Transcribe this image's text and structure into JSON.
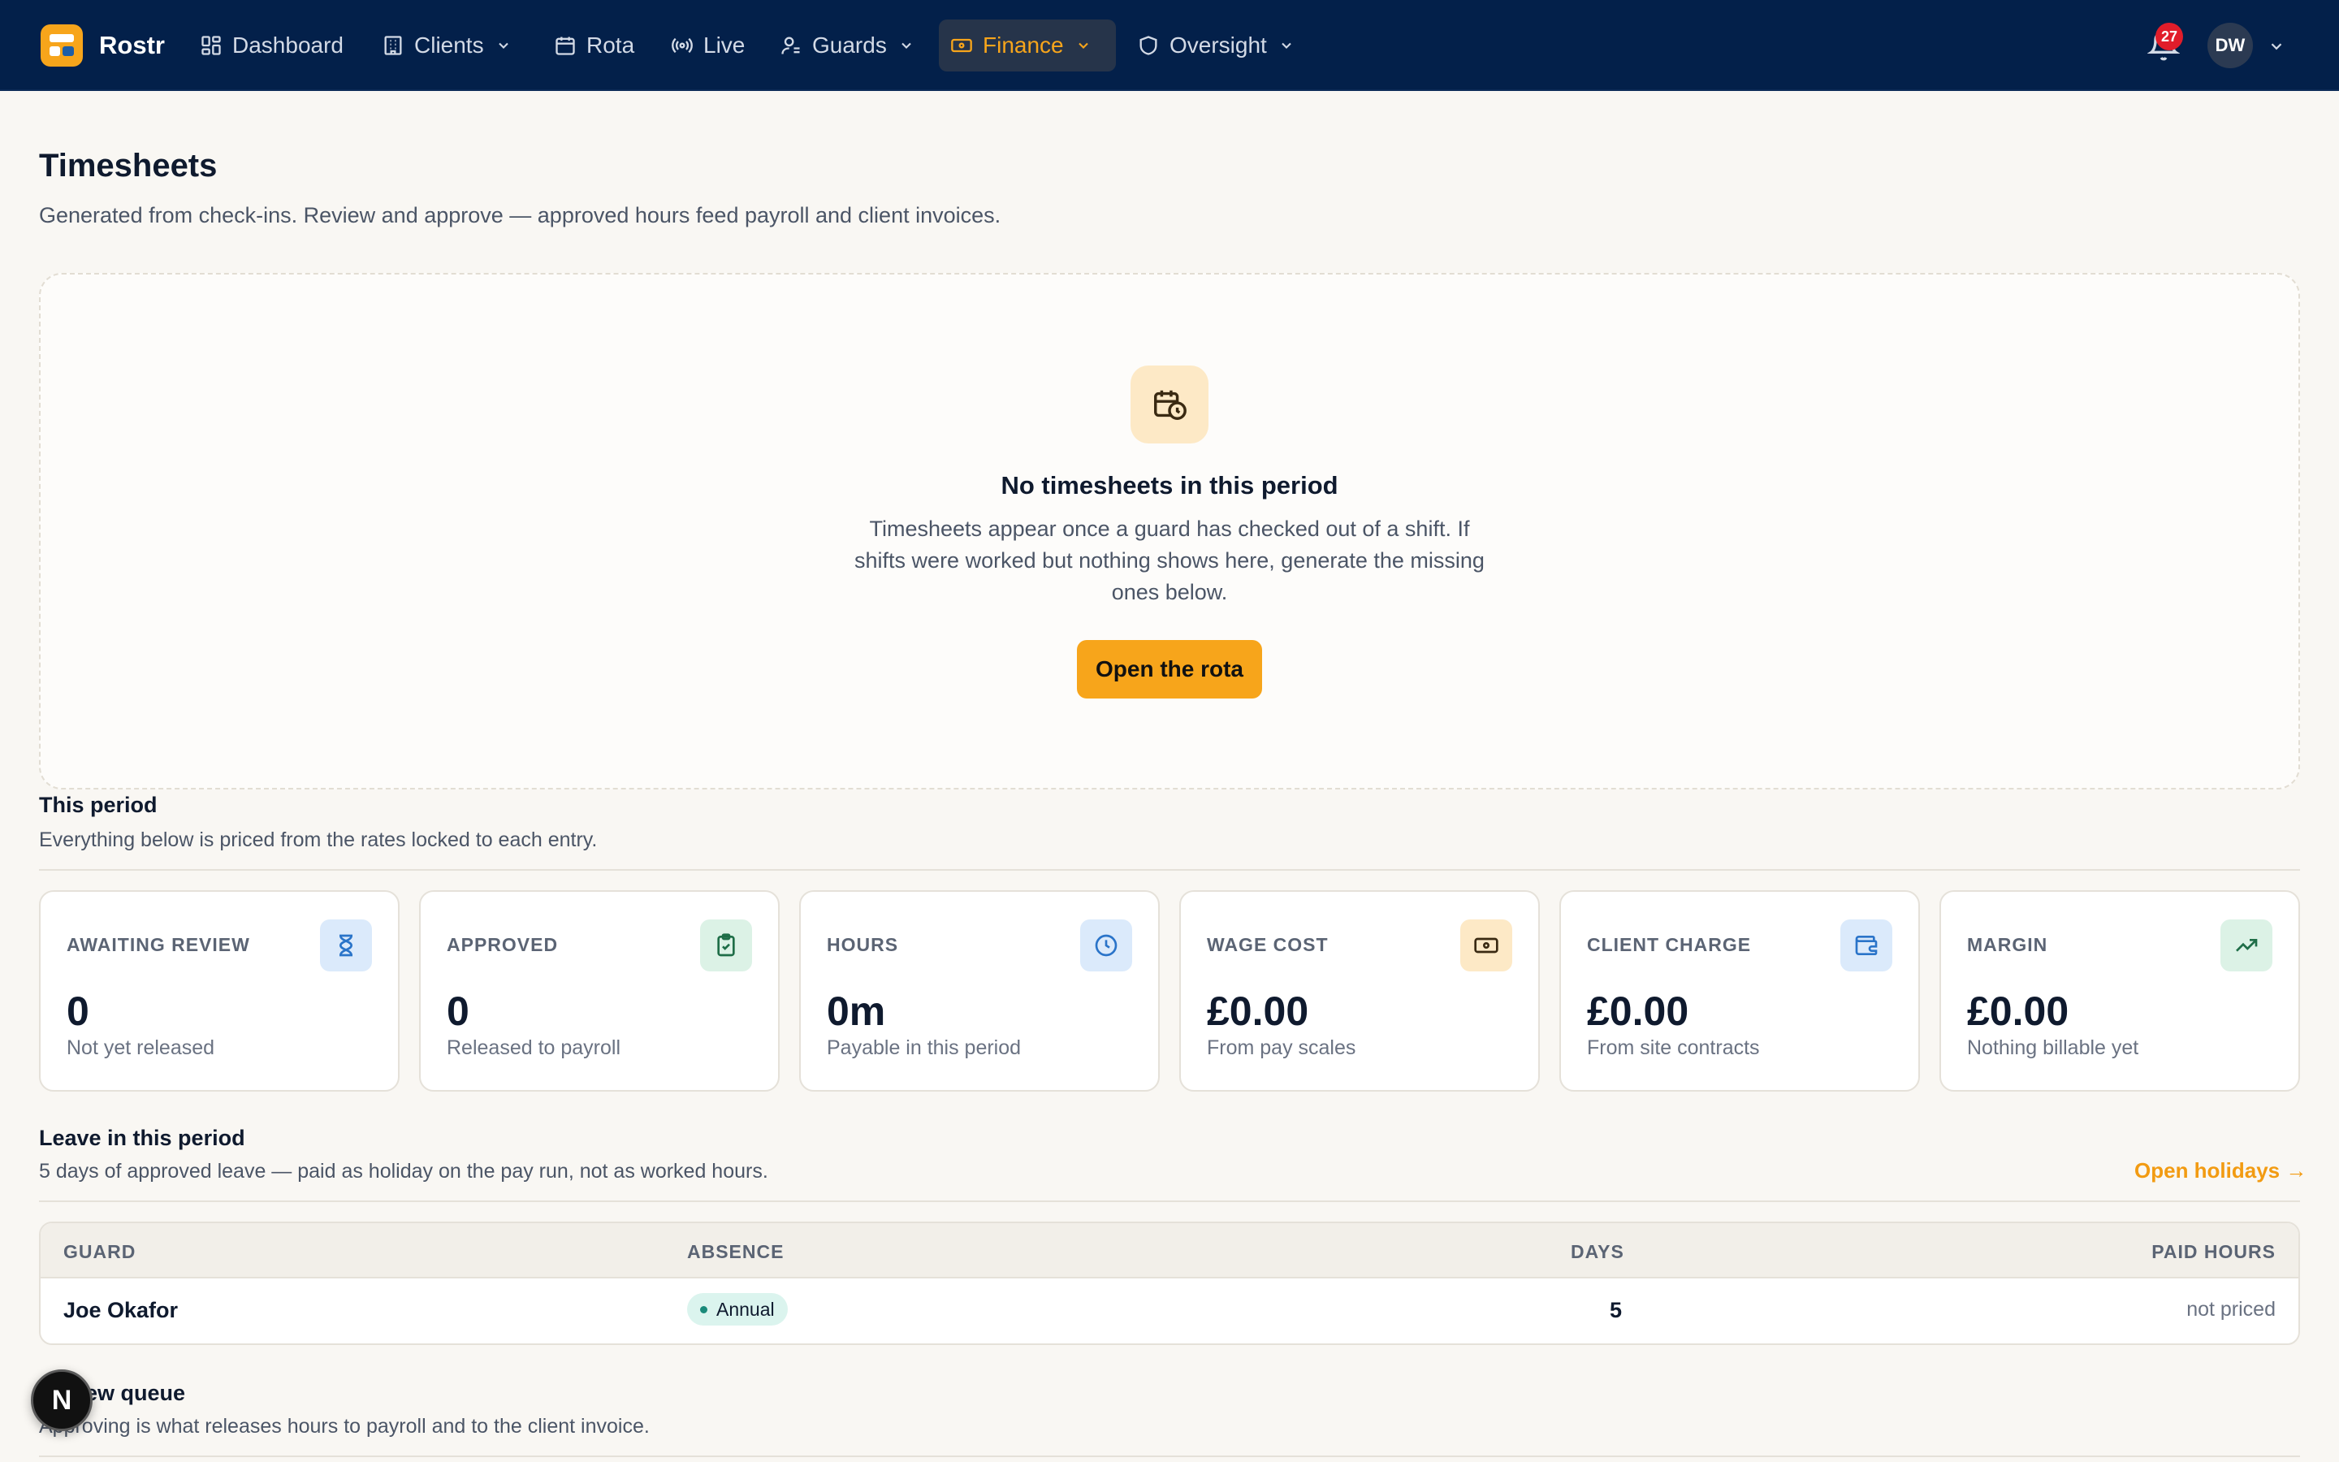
{
  "brand": {
    "name": "Rostr"
  },
  "nav": {
    "items": [
      {
        "label": "Dashboard",
        "icon": "grid-icon",
        "dropdown": false
      },
      {
        "label": "Clients",
        "icon": "building-icon",
        "dropdown": true
      },
      {
        "label": "Rota",
        "icon": "calendar-icon",
        "dropdown": false
      },
      {
        "label": "Live",
        "icon": "broadcast-icon",
        "dropdown": false
      },
      {
        "label": "Guards",
        "icon": "user-icon",
        "dropdown": true
      },
      {
        "label": "Finance",
        "icon": "banknote-icon",
        "dropdown": true,
        "active": true
      },
      {
        "label": "Oversight",
        "icon": "shield-icon",
        "dropdown": true
      }
    ],
    "notifications_count": "27",
    "user_initials": "DW"
  },
  "page": {
    "title": "Timesheets",
    "subtitle": "Generated from check-ins. Review and approve — approved hours feed payroll and client invoices."
  },
  "empty_state": {
    "title": "No timesheets in this period",
    "text": "Timesheets appear once a guard has checked out of a shift. If shifts were worked but nothing shows here, generate the missing ones below.",
    "button": "Open the rota"
  },
  "period": {
    "title": "This period",
    "subtitle": "Everything below is priced from the rates locked to each entry.",
    "cards": [
      {
        "label": "AWAITING REVIEW",
        "value": "0",
        "note": "Not yet released",
        "icon": "hourglass-icon",
        "color": "#dbeafb"
      },
      {
        "label": "APPROVED",
        "value": "0",
        "note": "Released to payroll",
        "icon": "clipboard-check-icon",
        "color": "#dcf2e6"
      },
      {
        "label": "HOURS",
        "value": "0m",
        "note": "Payable in this period",
        "icon": "clock-icon",
        "color": "#dbeafb"
      },
      {
        "label": "WAGE COST",
        "value": "£0.00",
        "note": "From pay scales",
        "icon": "banknote-icon",
        "color": "#fde9c6"
      },
      {
        "label": "CLIENT CHARGE",
        "value": "£0.00",
        "note": "From site contracts",
        "icon": "wallet-icon",
        "color": "#dbeafb"
      },
      {
        "label": "MARGIN",
        "value": "£0.00",
        "note": "Nothing billable yet",
        "icon": "trending-up-icon",
        "color": "#dcf2e6"
      }
    ]
  },
  "leave": {
    "title": "Leave in this period",
    "subtitle": "5 days of approved leave — paid as holiday on the pay run, not as worked hours.",
    "link": "Open holidays →",
    "columns": [
      "GUARD",
      "ABSENCE",
      "DAYS",
      "PAID HOURS"
    ],
    "rows": [
      {
        "guard": "Joe Okafor",
        "absence": "Annual",
        "days": "5",
        "paid_hours": "not priced"
      }
    ]
  },
  "review_queue": {
    "title": "Review queue",
    "subtitle": "Approving is what releases hours to payroll and to the client invoice."
  },
  "fab": {
    "label": "N"
  }
}
